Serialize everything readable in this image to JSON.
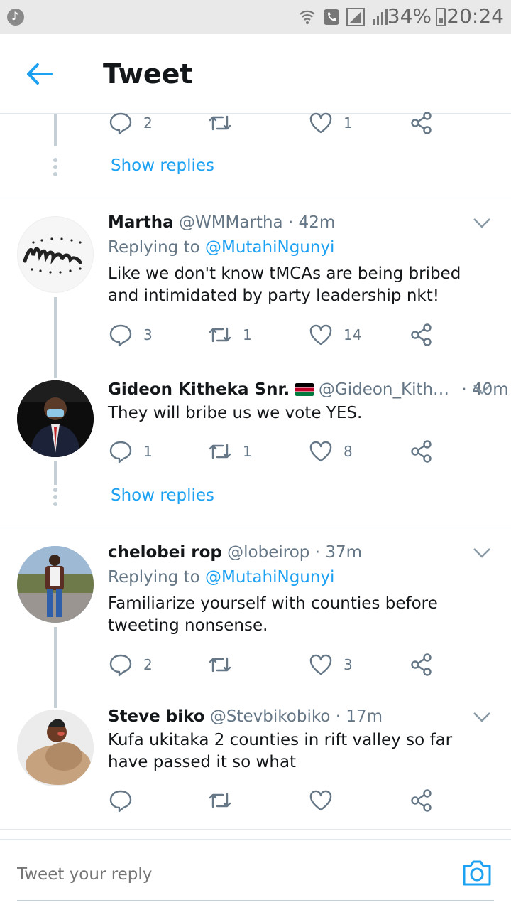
{
  "status_bar": {
    "battery": "34%",
    "time": "20:24"
  },
  "header": {
    "title": "Tweet"
  },
  "top_partial": {
    "reply_count": "2",
    "like_count": "1",
    "show_replies": "Show replies"
  },
  "tweets": [
    {
      "name": "Martha",
      "handle": "@WMMartha",
      "time": "· 42m",
      "replying_label": "Replying to",
      "replying_to": "@MutahiNgunyi",
      "text": "Like we don't know tMCAs are being bribed and intimidated by party leadership nkt!",
      "reply_count": "3",
      "retweet_count": "1",
      "like_count": "14"
    },
    {
      "name": "Gideon Kitheka Snr.",
      "handle": "@Gideon_Kith…",
      "time": "· 40m",
      "text": "They will bribe us we vote YES.",
      "reply_count": "1",
      "retweet_count": "1",
      "like_count": "8",
      "show_replies": "Show replies"
    },
    {
      "name": "chelobei rop",
      "handle": "@lobeirop",
      "time": "· 37m",
      "replying_label": "Replying to",
      "replying_to": "@MutahiNgunyi",
      "text": "Familiarize yourself with counties before tweeting nonsense.",
      "reply_count": "2",
      "retweet_count": "",
      "like_count": "3"
    },
    {
      "name": "Steve biko",
      "handle": "@Stevbikobiko",
      "time": "· 17m",
      "text": "Kufa ukitaka 2 counties in rift valley so far have passed it so what",
      "reply_count": "",
      "retweet_count": "",
      "like_count": ""
    }
  ],
  "footer": {
    "placeholder": "Tweet your reply"
  },
  "colors": {
    "accent": "#1da1f2",
    "muted": "#657786",
    "divider": "#e1e8ed"
  }
}
